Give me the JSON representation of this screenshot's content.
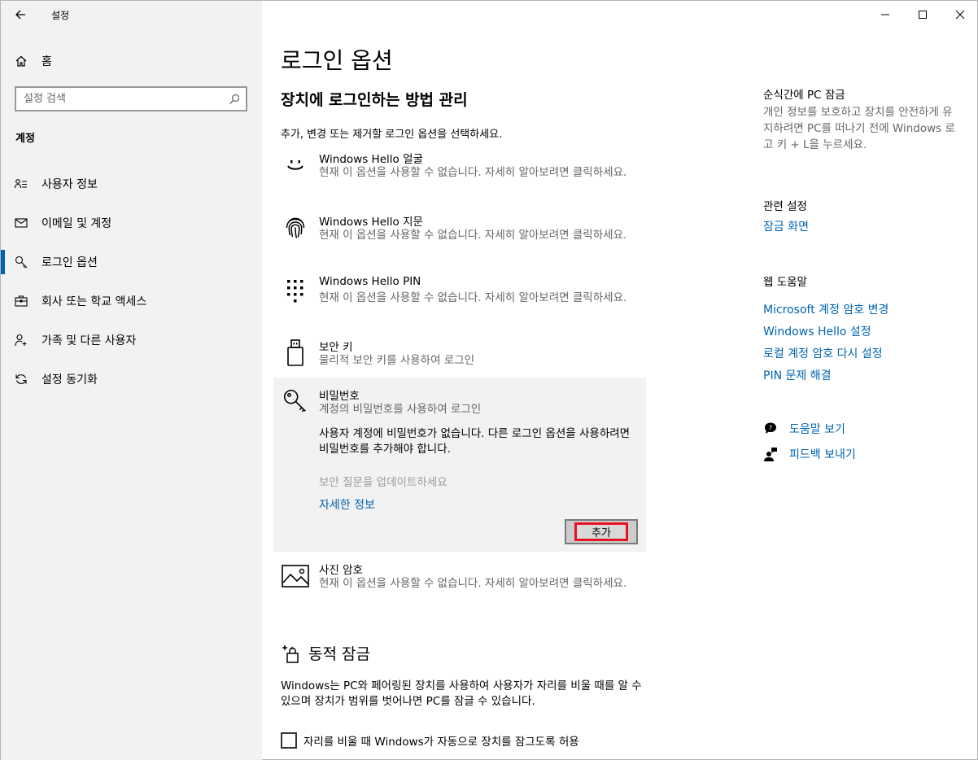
{
  "app": {
    "title": "설정"
  },
  "window_controls": {
    "minimize": "—",
    "maximize": "☐",
    "close": "✕"
  },
  "sidebar": {
    "home_label": "홈",
    "search_placeholder": "설정 검색",
    "section": "계정",
    "items": [
      {
        "label": "사용자 정보",
        "icon": "person-card-icon",
        "active": false
      },
      {
        "label": "이메일 및 계정",
        "icon": "mail-icon",
        "active": false
      },
      {
        "label": "로그인 옵션",
        "icon": "key-icon",
        "active": true
      },
      {
        "label": "회사 또는 학교 액세스",
        "icon": "briefcase-icon",
        "active": false
      },
      {
        "label": "가족 및 다른 사용자",
        "icon": "person-add-icon",
        "active": false
      },
      {
        "label": "설정 동기화",
        "icon": "sync-icon",
        "active": false
      }
    ]
  },
  "main": {
    "title": "로그인 옵션",
    "subtitle": "장치에 로그인하는 방법 관리",
    "description": "추가, 변경 또는 제거할 로그인 옵션을 선택하세요.",
    "options": [
      {
        "title": "Windows Hello 얼굴",
        "desc": "현재 이 옵션을 사용할 수 없습니다. 자세히 알아보려면 클릭하세요.",
        "icon": "face-icon"
      },
      {
        "title": "Windows Hello 지문",
        "desc": "현재 이 옵션을 사용할 수 없습니다. 자세히 알아보려면 클릭하세요.",
        "icon": "fingerprint-icon"
      },
      {
        "title": "Windows Hello PIN",
        "desc": "현재 이 옵션을 사용할 수 없습니다. 자세히 알아보려면 클릭하세요.",
        "icon": "pin-keypad-icon"
      },
      {
        "title": "보안 키",
        "desc": "물리적 보안 키를 사용하여 로그인",
        "icon": "usb-key-icon"
      }
    ],
    "password": {
      "title": "비밀번호",
      "desc": "계정의 비밀번호를 사용하여 로그인",
      "message": "사용자 계정에 비밀번호가 없습니다. 다른 로그인 옵션을 사용하려면 비밀번호를 추가해야 합니다.",
      "update_security": "보안 질문을 업데이트하세요",
      "more_info": "자세한 정보",
      "add_button": "추가"
    },
    "picture_password": {
      "title": "사진 암호",
      "desc": "현재 이 옵션을 사용할 수 없습니다. 자세히 알아보려면 클릭하세요."
    },
    "dynamic_lock": {
      "title": "동적 잠금",
      "desc": "Windows는 PC와 페어링된 장치를 사용하여 사용자가 자리를 비울 때를 알 수 있으며 장치가 범위를 벗어나면 PC를 잠글 수 있습니다.",
      "checkbox_label": "자리를 비울 때 Windows가 자동으로 장치를 잠그도록 허용"
    }
  },
  "right": {
    "lock_title": "순식간에 PC 잠금",
    "lock_text": "개인 정보를 보호하고 장치를 안전하게 유지하려면 PC를 떠나기 전에 Windows 로고 키 + L을 누르세요.",
    "related_title": "관련 설정",
    "related_link": "잠금 화면",
    "web_help_title": "웹 도움말",
    "web_links": [
      "Microsoft 계정 암호 변경",
      "Windows Hello 설정",
      "로컬 계정 암호 다시 설정",
      "PIN 문제 해결"
    ],
    "get_help": "도움말 보기",
    "feedback": "피드백 보내기"
  }
}
